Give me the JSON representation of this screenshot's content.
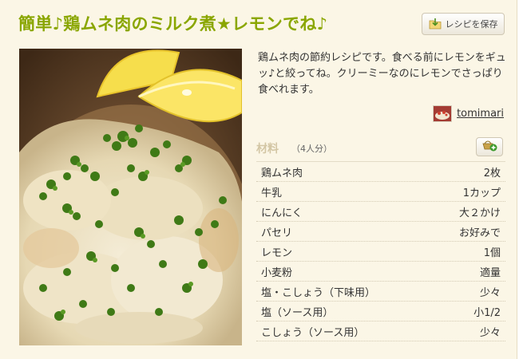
{
  "recipe": {
    "title": "簡単♪鶏ムネ肉のミルク煮★レモンでね♪",
    "description": "鶏ムネ肉の節約レシピです。食べる前にレモンをギュッ♪と絞ってね。クリーミーなのにレモンでさっぱり食べれます。",
    "author": "tomimari"
  },
  "toolbar": {
    "save_label": "レシピを保存",
    "save_icon": "folder-save-icon"
  },
  "ingredients": {
    "title": "材料",
    "servings": "（4人分）",
    "add_icon": "basket-add-icon",
    "items": [
      {
        "name": "鶏ムネ肉",
        "qty": "2枚"
      },
      {
        "name": "牛乳",
        "qty": "1カップ"
      },
      {
        "name": "にんにく",
        "qty": "大２かけ"
      },
      {
        "name": "パセリ",
        "qty": "お好みで"
      },
      {
        "name": "レモン",
        "qty": "1個"
      },
      {
        "name": "小麦粉",
        "qty": "適量"
      },
      {
        "name": "塩・こしょう（下味用）",
        "qty": "少々"
      },
      {
        "name": "塩（ソース用）",
        "qty": "小1/2"
      },
      {
        "name": "こしょう（ソース用）",
        "qty": "少々"
      }
    ]
  },
  "colors": {
    "title": "#8aa600",
    "background": "#fbf6e6",
    "materials_heading": "#d3c6a4"
  }
}
